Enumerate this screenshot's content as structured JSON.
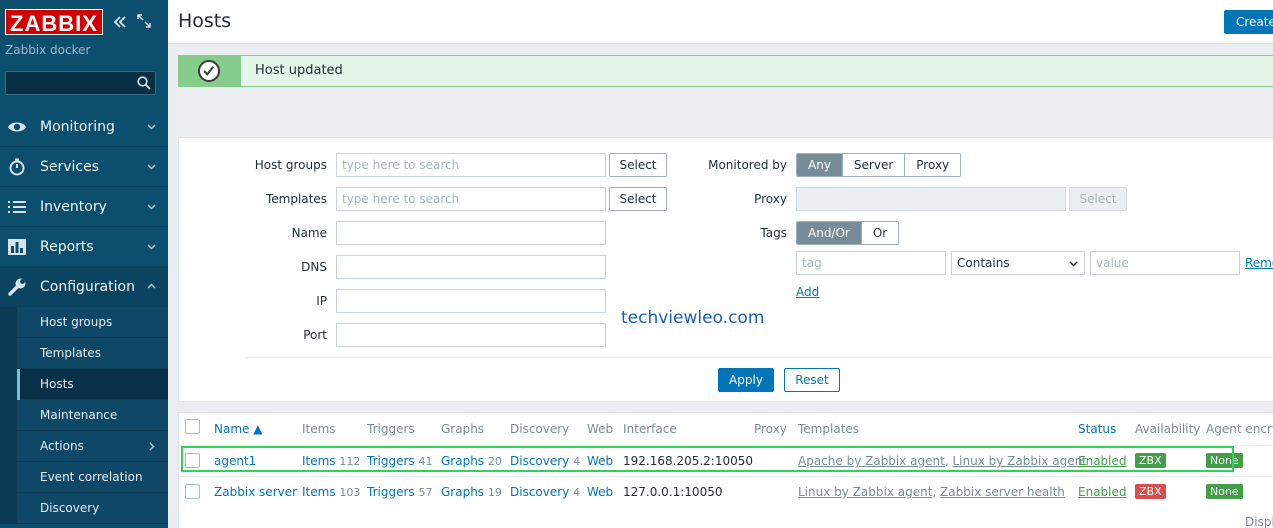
{
  "brand": {
    "logo": "ZABBIX",
    "server_name": "Zabbix docker"
  },
  "sidebar": {
    "search_placeholder": "",
    "menu": [
      {
        "label": "Monitoring",
        "icon": "eye-icon"
      },
      {
        "label": "Services",
        "icon": "stopwatch-icon"
      },
      {
        "label": "Inventory",
        "icon": "list-icon"
      },
      {
        "label": "Reports",
        "icon": "bar-chart-icon"
      },
      {
        "label": "Configuration",
        "icon": "wrench-icon"
      }
    ],
    "submenu": [
      {
        "label": "Host groups"
      },
      {
        "label": "Templates"
      },
      {
        "label": "Hosts"
      },
      {
        "label": "Maintenance"
      },
      {
        "label": "Actions"
      },
      {
        "label": "Event correlation"
      },
      {
        "label": "Discovery"
      }
    ]
  },
  "header": {
    "title": "Hosts",
    "create_label": "Create"
  },
  "message": {
    "text": "Host updated",
    "color": "#86cc8c"
  },
  "filter": {
    "host_groups_label": "Host groups",
    "templates_label": "Templates",
    "name_label": "Name",
    "dns_label": "DNS",
    "ip_label": "IP",
    "port_label": "Port",
    "search_placeholder": "type here to search",
    "select_label": "Select",
    "monitored_by_label": "Monitored by",
    "monitored_by_options": [
      "Any",
      "Server",
      "Proxy"
    ],
    "proxy_label": "Proxy",
    "tags_label": "Tags",
    "tags_options": [
      "And/Or",
      "Or"
    ],
    "tag_placeholder": "tag",
    "tag_operator": "Contains",
    "value_placeholder": "value",
    "remove_label": "Remove",
    "add_label": "Add",
    "apply_label": "Apply",
    "reset_label": "Reset"
  },
  "watermark": "techviewleo.com",
  "table": {
    "columns": {
      "name": "Name ▲",
      "items": "Items",
      "triggers": "Triggers",
      "graphs": "Graphs",
      "discovery": "Discovery",
      "web": "Web",
      "interface": "Interface",
      "proxy": "Proxy",
      "templates": "Templates",
      "status": "Status",
      "availability": "Availability",
      "agent_encryption": "Agent encryption"
    },
    "rows": [
      {
        "name": "agent1",
        "items_label": "Items",
        "items_count": "112",
        "triggers_label": "Triggers",
        "triggers_count": "41",
        "graphs_label": "Graphs",
        "graphs_count": "20",
        "discovery_label": "Discovery",
        "discovery_count": "4",
        "web": "Web",
        "interface": "192.168.205.2:10050",
        "template1": "Apache by Zabbix agent",
        "sep": ", ",
        "template2": "Linux by Zabbix agent",
        "status": "Enabled",
        "availability": "ZBX",
        "availability_color": "#429e47",
        "encryption": "None"
      },
      {
        "name": "Zabbix server",
        "items_label": "Items",
        "items_count": "103",
        "triggers_label": "Triggers",
        "triggers_count": "57",
        "graphs_label": "Graphs",
        "graphs_count": "19",
        "discovery_label": "Discovery",
        "discovery_count": "4",
        "web": "Web",
        "interface": "127.0.0.1:10050",
        "template1": "Linux by Zabbix agent",
        "sep": ", ",
        "template2": "Zabbix server health",
        "status": "Enabled",
        "availability": "ZBX",
        "availability_color": "#d64e4e",
        "encryption": "None"
      }
    ],
    "footer": "Displaying"
  }
}
